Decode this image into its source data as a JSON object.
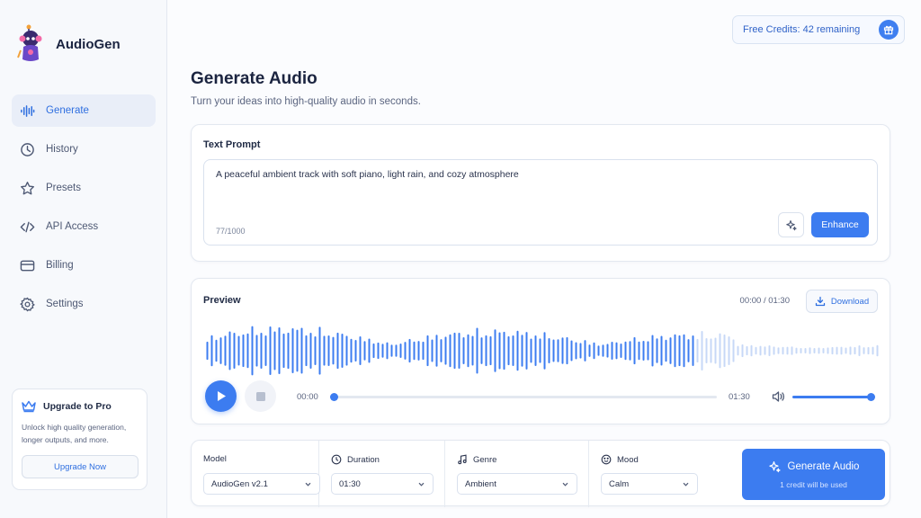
{
  "brand": {
    "name": "AudioGen"
  },
  "sidebar": {
    "items": [
      {
        "label": "Generate",
        "icon": "waveform-icon",
        "active": true
      },
      {
        "label": "History",
        "icon": "clock-icon",
        "active": false
      },
      {
        "label": "Presets",
        "icon": "star-icon",
        "active": false
      },
      {
        "label": "API Access",
        "icon": "code-icon",
        "active": false
      },
      {
        "label": "Billing",
        "icon": "card-icon",
        "active": false
      },
      {
        "label": "Settings",
        "icon": "gear-icon",
        "active": false
      }
    ],
    "upgrade": {
      "title": "Upgrade to Pro",
      "text": "Unlock high quality generation, longer outputs, and more.",
      "button": "Upgrade Now"
    }
  },
  "header": {
    "credits": "Free Credits: 42 remaining"
  },
  "main": {
    "title": "Generate Audio",
    "subtitle": "Turn your ideas into high-quality audio in seconds."
  },
  "prompt": {
    "label": "Text Prompt",
    "value": "A peaceful ambient track with soft piano, light rain, and cozy atmosphere",
    "char_count": "77/1000",
    "enhance_label": "Enhance"
  },
  "preview": {
    "label": "Preview",
    "time_display": "00:00 / 01:30",
    "download_label": "Download",
    "current_time": "00:00",
    "end_time": "01:30",
    "progress": 0,
    "volume": 1.0
  },
  "settings": {
    "model": {
      "label": "Model",
      "value": "AudioGen v2.1"
    },
    "duration": {
      "label": "Duration",
      "value": "01:30"
    },
    "genre": {
      "label": "Genre",
      "value": "Ambient"
    },
    "mood": {
      "label": "Mood",
      "value": "Calm"
    }
  },
  "generate": {
    "label": "Generate Audio",
    "sub": "1 credit will be used"
  },
  "colors": {
    "accent": "#3c7cf0",
    "accent_text": "#2f6fe0",
    "wave_light": "#c7d8f7"
  }
}
